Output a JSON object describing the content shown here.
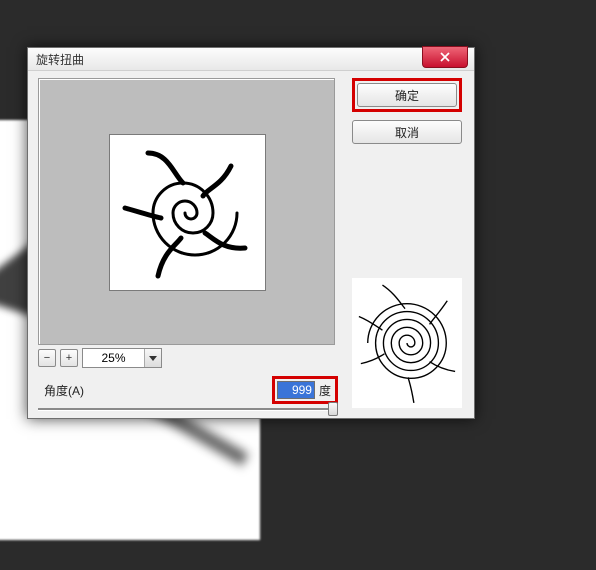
{
  "dialog": {
    "title": "旋转扭曲",
    "close_icon": "close"
  },
  "buttons": {
    "ok": "确定",
    "cancel": "取消"
  },
  "zoom": {
    "minus": "−",
    "plus": "+",
    "value": "25%"
  },
  "angle": {
    "label": "角度(A)",
    "value": "999",
    "unit": "度",
    "min": -999,
    "max": 999,
    "slider_pos_percent": 100
  },
  "highlights": {
    "ok_button": true,
    "angle_input": true
  }
}
